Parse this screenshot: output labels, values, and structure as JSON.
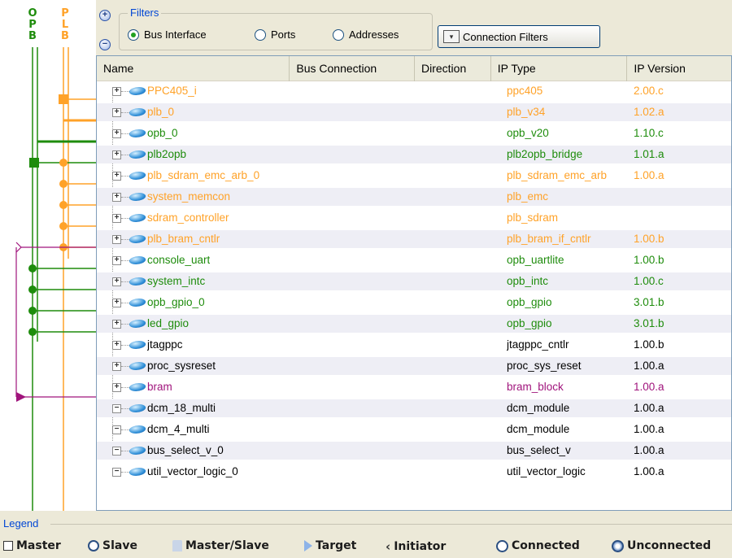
{
  "bus_panel": {
    "opb_label": [
      "O",
      "P",
      "B"
    ],
    "plb_label": [
      "P",
      "L",
      "B"
    ],
    "colors": {
      "opb": "#1e8c0c",
      "plb": "#ffa228",
      "bram": "#a0147c"
    }
  },
  "filters": {
    "title": "Filters",
    "radio_options": [
      {
        "label": "Bus Interface",
        "selected": true
      },
      {
        "label": "Ports",
        "selected": false
      },
      {
        "label": "Addresses",
        "selected": false
      }
    ],
    "connection_filters_label": "Connection Filters",
    "expand_all_symbol": "+",
    "collapse_all_symbol": "−"
  },
  "table": {
    "columns": [
      "Name",
      "Bus Connection",
      "Direction",
      "IP Type",
      "IP Version"
    ],
    "rows": [
      {
        "name": "PPC405_i",
        "ip_type": "ppc405",
        "ip_version": "2.00.c",
        "color": "orange",
        "expander": "+"
      },
      {
        "name": "plb_0",
        "ip_type": "plb_v34",
        "ip_version": "1.02.a",
        "color": "orange",
        "expander": "+"
      },
      {
        "name": "opb_0",
        "ip_type": "opb_v20",
        "ip_version": "1.10.c",
        "color": "green",
        "expander": "+"
      },
      {
        "name": "plb2opb",
        "ip_type": "plb2opb_bridge",
        "ip_version": "1.01.a",
        "color": "green",
        "expander": "+"
      },
      {
        "name": "plb_sdram_emc_arb_0",
        "ip_type": "plb_sdram_emc_arb",
        "ip_version": "1.00.a",
        "color": "orange",
        "expander": "+"
      },
      {
        "name": "system_memcon",
        "ip_type": "plb_emc",
        "ip_version": "",
        "color": "orange",
        "expander": "+"
      },
      {
        "name": "sdram_controller",
        "ip_type": "plb_sdram",
        "ip_version": "",
        "color": "orange",
        "expander": "+"
      },
      {
        "name": "plb_bram_cntlr",
        "ip_type": "plb_bram_if_cntlr",
        "ip_version": "1.00.b",
        "color": "orange",
        "expander": "+"
      },
      {
        "name": "console_uart",
        "ip_type": "opb_uartlite",
        "ip_version": "1.00.b",
        "color": "green",
        "expander": "+"
      },
      {
        "name": "system_intc",
        "ip_type": "opb_intc",
        "ip_version": "1.00.c",
        "color": "green",
        "expander": "+"
      },
      {
        "name": "opb_gpio_0",
        "ip_type": "opb_gpio",
        "ip_version": "3.01.b",
        "color": "green",
        "expander": "+"
      },
      {
        "name": "led_gpio",
        "ip_type": "opb_gpio",
        "ip_version": "3.01.b",
        "color": "green",
        "expander": "+"
      },
      {
        "name": "jtagppc",
        "ip_type": "jtagppc_cntlr",
        "ip_version": "1.00.b",
        "color": "black",
        "expander": "+"
      },
      {
        "name": "proc_sysreset",
        "ip_type": "proc_sys_reset",
        "ip_version": "1.00.a",
        "color": "black",
        "expander": "+"
      },
      {
        "name": "bram",
        "ip_type": "bram_block",
        "ip_version": "1.00.a",
        "color": "purple",
        "expander": "+"
      },
      {
        "name": "dcm_18_multi",
        "ip_type": "dcm_module",
        "ip_version": "1.00.a",
        "color": "black",
        "expander": "−"
      },
      {
        "name": "dcm_4_multi",
        "ip_type": "dcm_module",
        "ip_version": "1.00.a",
        "color": "black",
        "expander": "−"
      },
      {
        "name": "bus_select_v_0",
        "ip_type": "bus_select_v",
        "ip_version": "1.00.a",
        "color": "black",
        "expander": "−"
      },
      {
        "name": "util_vector_logic_0",
        "ip_type": "util_vector_logic",
        "ip_version": "1.00.a",
        "color": "black",
        "expander": "−"
      }
    ]
  },
  "legend": {
    "title": "Legend",
    "items": [
      "Master",
      "Slave",
      "Master/Slave",
      "Target",
      "Initiator",
      "Connected",
      "Unconnected"
    ]
  }
}
